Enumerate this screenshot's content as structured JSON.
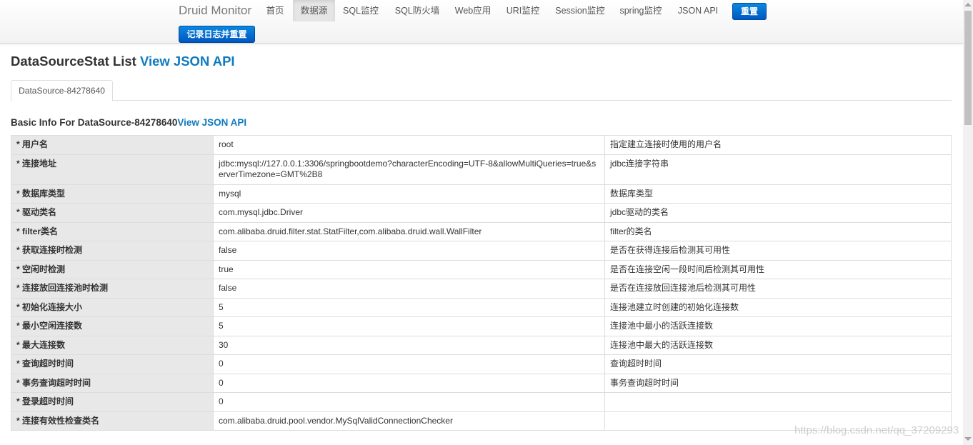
{
  "navbar": {
    "brand": "Druid Monitor",
    "items": [
      {
        "label": "首页"
      },
      {
        "label": "数据源"
      },
      {
        "label": "SQL监控"
      },
      {
        "label": "SQL防火墙"
      },
      {
        "label": "Web应用"
      },
      {
        "label": "URI监控"
      },
      {
        "label": "Session监控"
      },
      {
        "label": "spring监控"
      },
      {
        "label": "JSON API"
      }
    ],
    "reset_label": "重置",
    "log_reset_label": "记录日志并重置"
  },
  "page": {
    "title": "DataSourceStat List ",
    "title_link": "View JSON API",
    "tab_label": "DataSource-84278640",
    "basic_title": "Basic Info For DataSource-84278640",
    "basic_link": "View JSON API"
  },
  "rows": [
    {
      "key": "* 用户名",
      "value": "root",
      "desc": "指定建立连接时使用的用户名"
    },
    {
      "key": "* 连接地址",
      "value": "jdbc:mysql://127.0.0.1:3306/springbootdemo?characterEncoding=UTF-8&allowMultiQueries=true&serverTimezone=GMT%2B8",
      "desc": "jdbc连接字符串"
    },
    {
      "key": "* 数据库类型",
      "value": "mysql",
      "desc": "数据库类型"
    },
    {
      "key": "* 驱动类名",
      "value": "com.mysql.jdbc.Driver",
      "desc": "jdbc驱动的类名"
    },
    {
      "key": "* filter类名",
      "value": "com.alibaba.druid.filter.stat.StatFilter,com.alibaba.druid.wall.WallFilter",
      "desc": "filter的类名"
    },
    {
      "key": "* 获取连接时检测",
      "value": "false",
      "desc": "是否在获得连接后检测其可用性"
    },
    {
      "key": "* 空闲时检测",
      "value": "true",
      "desc": "是否在连接空闲一段时间后检测其可用性"
    },
    {
      "key": "* 连接放回连接池时检测",
      "value": "false",
      "desc": "是否在连接放回连接池后检测其可用性"
    },
    {
      "key": "* 初始化连接大小",
      "value": "5",
      "desc": "连接池建立时创建的初始化连接数"
    },
    {
      "key": "* 最小空闲连接数",
      "value": "5",
      "desc": "连接池中最小的活跃连接数"
    },
    {
      "key": "* 最大连接数",
      "value": "30",
      "desc": "连接池中最大的活跃连接数"
    },
    {
      "key": "* 查询超时时间",
      "value": "0",
      "desc": "查询超时时间"
    },
    {
      "key": "* 事务查询超时时间",
      "value": "0",
      "desc": "事务查询超时时间"
    },
    {
      "key": "* 登录超时时间",
      "value": "0",
      "desc": ""
    },
    {
      "key": "* 连接有效性检查类名",
      "value": "com.alibaba.druid.pool.vendor.MySqlValidConnectionChecker",
      "desc": ""
    }
  ],
  "watermark": "https://blog.csdn.net/qq_37209293"
}
